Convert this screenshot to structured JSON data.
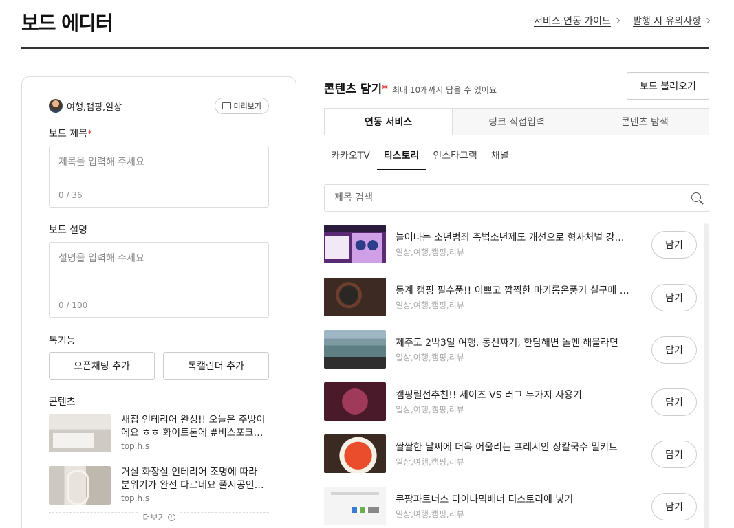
{
  "header": {
    "title": "보드 에디터",
    "links": [
      "서비스 연동 가이드",
      "발행 시 유의사항"
    ]
  },
  "left": {
    "channel_name": "여행,캠핑,일상",
    "preview_label": "미리보기",
    "title_label": "보드 제목",
    "required_mark": "*",
    "title_placeholder": "제목을 입력해 주세요",
    "title_counter": "0 / 36",
    "desc_label": "보드 설명",
    "desc_placeholder": "설명을 입력해 주세요",
    "desc_counter": "0 / 100",
    "features_label": "톡기능",
    "features": [
      "오픈채팅 추가",
      "톡캘린더 추가"
    ],
    "contents_label": "콘텐츠",
    "contents": [
      {
        "title": "새집 인테리어 완성!! 오늘은 주방이에요 ㅎㅎ 화이트톤에 #비스포크식기세척기 설치",
        "author": "top.h.s"
      },
      {
        "title": "거실 화장실 인테리어 조명에 따라 분위기가 완전 다르네요 풀시공인테리어 후기",
        "author": "top.h.s"
      }
    ],
    "more_label": "더보기"
  },
  "right": {
    "section_title": "콘텐츠 담기",
    "required_mark": "*",
    "section_sub": "최대 10개까지 담을 수 있어요",
    "load_button": "보드 불러오기",
    "main_tabs": [
      "연동 서비스",
      "링크 직접입력",
      "콘텐츠 탐색"
    ],
    "sub_tabs": [
      "카카오TV",
      "티스토리",
      "인스타그램",
      "채널"
    ],
    "search_placeholder": "제목 검색",
    "items": [
      {
        "title": "늘어나는 소년범죄 촉법소년제도 개선으로 형사처벌 강화해야",
        "tags": "일상,여행,캠핑,리뷰",
        "button": "담기"
      },
      {
        "title": "동계 캠핑 필수품!! 이쁘고 깜찍한 마키롱온풍기 실구매 후기",
        "tags": "일상,여행,캠핑,리뷰",
        "button": "담기"
      },
      {
        "title": "제주도 2박3일 여행. 동선짜기, 한담해변 놀멘 해물라면",
        "tags": "일상,여행,캠핑,리뷰",
        "button": "담기"
      },
      {
        "title": "캠핑릴선추천!! 세이즈 VS 러그 두가지 사용기",
        "tags": "일상,여행,캠핑,리뷰",
        "button": "담기"
      },
      {
        "title": "쌀쌀한 날씨에 더욱 어울리는 프레시안 장칼국수 밀키트",
        "tags": "일상,여행,캠핑,리뷰",
        "button": "담기"
      },
      {
        "title": "쿠팡파트너스 다이나믹배너 티스토리에 넣기",
        "tags": "일상,여행,캠핑,리뷰",
        "button": "담기"
      }
    ]
  }
}
